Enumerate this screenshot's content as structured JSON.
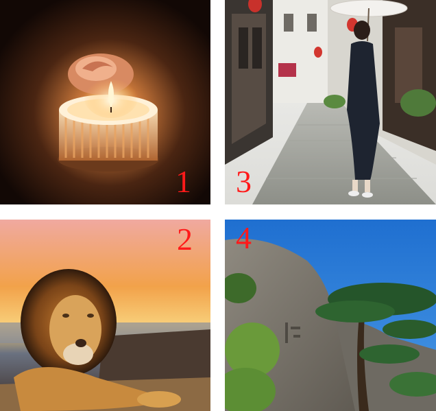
{
  "tiles": [
    {
      "number": "1",
      "subject": "candle-with-rose"
    },
    {
      "number": "3",
      "subject": "alley-woman-with-parasol"
    },
    {
      "number": "2",
      "subject": "lion-at-sunset"
    },
    {
      "number": "4",
      "subject": "pine-tree-on-granite-cliff"
    }
  ],
  "colors": {
    "label": "#ff1a1a",
    "sky_blue": "#2f7fd6",
    "sunset_orange": "#f2a24a"
  }
}
